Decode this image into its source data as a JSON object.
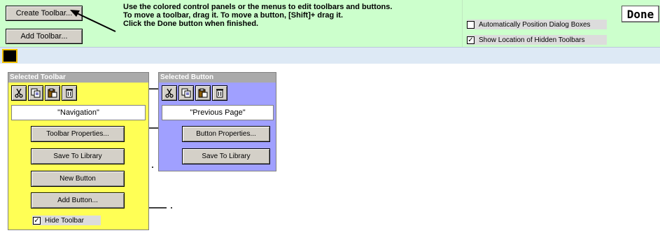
{
  "topbar": {
    "create_toolbar": "Create Toolbar...",
    "add_toolbar": "Add Toolbar...",
    "instructions": [
      "Use the colored control panels or the menus to edit toolbars and buttons.",
      "To move a toolbar, drag it. To move a button, [Shift]+ drag it.",
      "Click the Done button when finished."
    ],
    "auto_position_label": "Automatically Position Dialog Boxes",
    "auto_position_checked": "",
    "show_hidden_label": "Show Location of Hidden Toolbars",
    "show_hidden_checked": "✓",
    "done": "Done"
  },
  "toolbar_panel": {
    "title": "Selected Toolbar",
    "name": "\"Navigation\"",
    "toolbar_properties": "Toolbar Properties...",
    "save_to_library": "Save To Library",
    "new_button": "New Button",
    "add_button": "Add Button...",
    "hide_toolbar_label": "Hide Toolbar",
    "hide_toolbar_checked": "✓"
  },
  "button_panel": {
    "title": "Selected Button",
    "name": "\"Previous Page\"",
    "button_properties": "Button Properties...",
    "save_to_library": "Save To Library"
  },
  "icons": [
    "cut-icon",
    "copy-icon",
    "paste-icon",
    "trash-icon"
  ],
  "colors": {
    "control_band": "#ccffcc",
    "strip": "#dde9f5",
    "toolbar_panel": "#ffff55",
    "button_panel": "#a0a0ff",
    "title_bar": "#aaaaaa"
  }
}
